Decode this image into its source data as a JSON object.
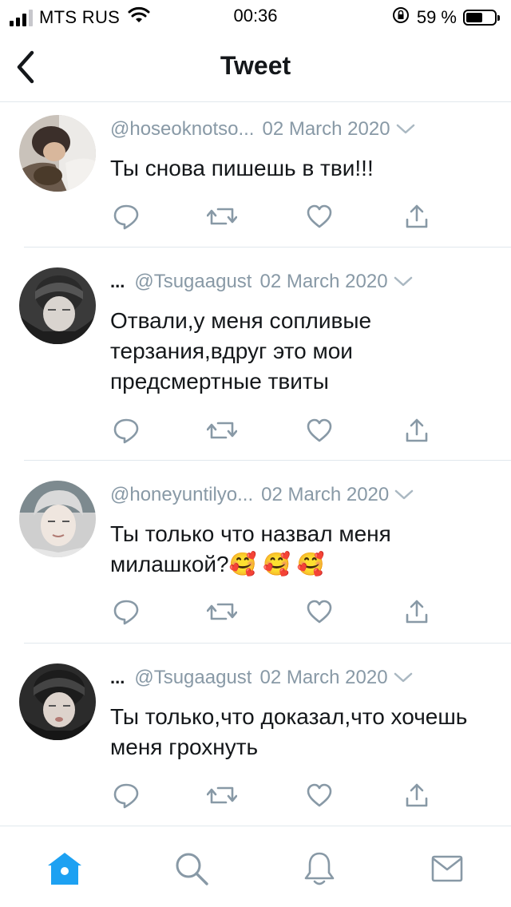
{
  "status_bar": {
    "carrier": "MTS RUS",
    "time": "00:36",
    "battery_percent": "59 %",
    "battery_level": 0.59
  },
  "header": {
    "title": "Tweet"
  },
  "tweets": [
    {
      "name": "",
      "handle": "@hoseoknotso...",
      "date": "02 March 2020",
      "text": "Ты снова пишешь в тви!!!"
    },
    {
      "name": "...",
      "handle": "@Tsugaagust",
      "date": "02 March 2020",
      "text": "Отвали,у меня сопливые терзания,вдруг это мои предсмертные твиты"
    },
    {
      "name": "",
      "handle": "@honeyuntilyo...",
      "date": "02 March 2020",
      "text": "Ты только что назвал меня милашкой?🥰 🥰 🥰"
    },
    {
      "name": "...",
      "handle": "@Tsugaagust",
      "date": "02 March 2020",
      "text": "Ты только,что доказал,что хочешь меня грохнуть"
    }
  ],
  "tab_bar": {
    "active": "home",
    "accent": "#1da1f2",
    "inactive_color": "#8899a6"
  },
  "icons": {
    "action_color": "#8899a6"
  }
}
